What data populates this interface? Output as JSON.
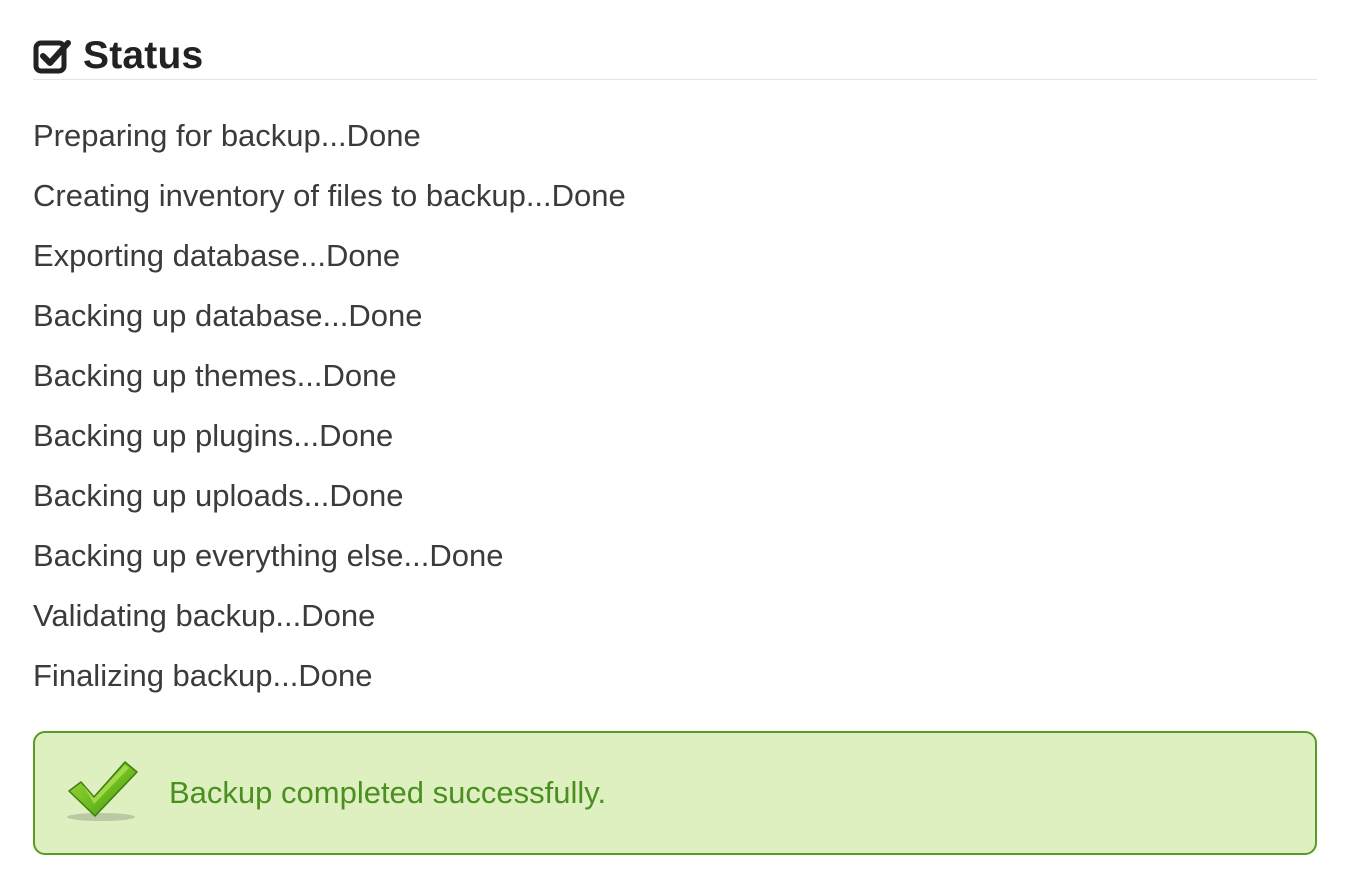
{
  "status_panel": {
    "title": "Status",
    "icon": "check-square-icon",
    "log": [
      "Preparing for backup...Done",
      "Creating inventory of files to backup...Done",
      "Exporting database...Done",
      "Backing up database...Done",
      "Backing up themes...Done",
      "Backing up plugins...Done",
      "Backing up uploads...Done",
      "Backing up everything else...Done",
      "Validating backup...Done",
      "Finalizing backup...Done"
    ]
  },
  "success_notice": {
    "icon": "green-checkmark-icon",
    "message": "Backup completed successfully.",
    "colors": {
      "background": "#dff0c0",
      "border": "#5a9a25",
      "text": "#4a8f20"
    }
  }
}
